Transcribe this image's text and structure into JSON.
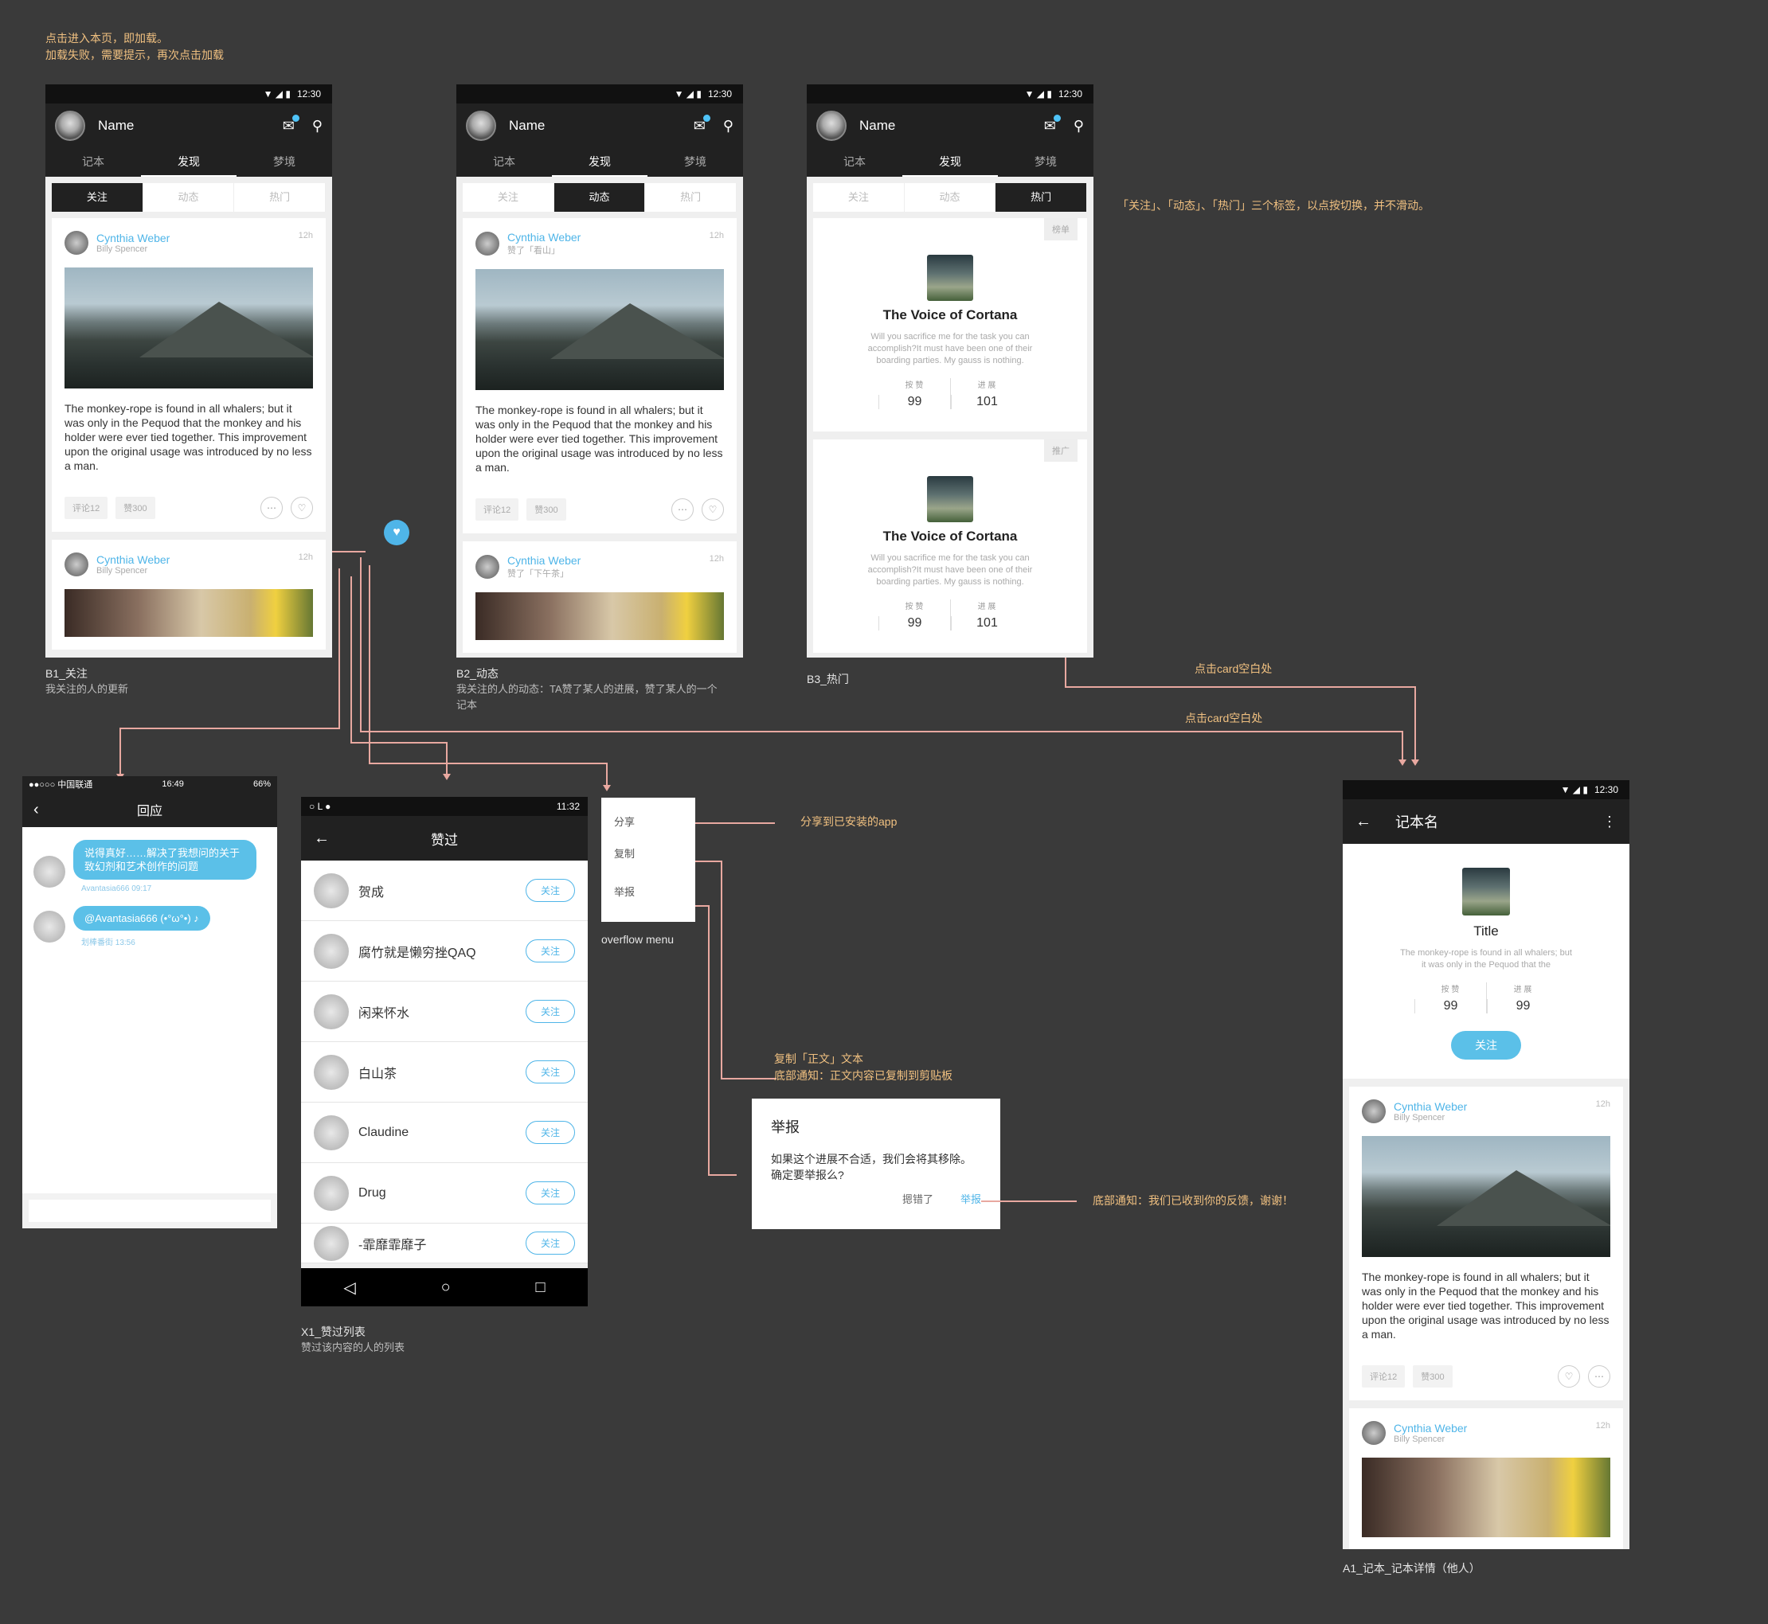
{
  "notes": {
    "top": [
      "点击进入本页，即加载。",
      "加载失败，需要提示，再次点击加载"
    ],
    "tabs_note": "「关注」、「动态」、「热门」三个标签，以点按切换，并不滑动。",
    "click_card_1": "点击card空白处",
    "click_card_2": "点击card空白处",
    "share": "分享到已安装的app",
    "copy": [
      "复制「正文」文本",
      "底部通知：正文内容已复制到剪贴板"
    ],
    "report_ok": "底部通知：我们已收到你的反馈，谢谢！"
  },
  "status": {
    "time": "12:30"
  },
  "app": {
    "name": "Name",
    "tabs": [
      "记本",
      "发现",
      "梦境"
    ],
    "seg": [
      "关注",
      "动态",
      "热门"
    ]
  },
  "b1": {
    "caption": "B1_关注",
    "sub": "我关注的人的更新",
    "card1": {
      "name": "Cynthia Weber",
      "sub": "Billy Spencer",
      "time": "12h",
      "body": "The monkey-rope is found in all whalers; but it was only in the Pequod that the monkey and his holder were ever tied together. This improvement upon the original usage was introduced by no less a man.",
      "comments": "评论12",
      "likes": "赞300"
    },
    "card2": {
      "name": "Cynthia Weber",
      "sub": "Billy Spencer",
      "time": "12h"
    }
  },
  "b2": {
    "caption": "B2_动态",
    "sub": "我关注的人的动态：TA赞了某人的进展，赞了某人的一个记本",
    "card1": {
      "name": "Cynthia Weber",
      "sub": "赞了「看山」",
      "time": "12h",
      "body": "The monkey-rope is found in all whalers; but it was only in the Pequod that the monkey and his holder were ever tied together. This improvement upon the original usage was introduced by no less a man.",
      "comments": "评论12",
      "likes": "赞300"
    },
    "card2": {
      "name": "Cynthia Weber",
      "sub": "赞了「下午茶」",
      "time": "12h"
    }
  },
  "b3": {
    "caption": "B3_热门",
    "card1": {
      "badge": "榜单",
      "title": "The Voice of Cortana",
      "desc": "Will you sacrifice me for the task you can accomplish?It must have been one of their boarding parties. My gauss is nothing.",
      "l1": "按 赞",
      "v1": "99",
      "l2": "进 展",
      "v2": "101"
    },
    "card2": {
      "badge": "推广",
      "title": "The Voice of Cortana",
      "desc": "Will you sacrifice me for the task you can accomplish?It must have been one of their boarding parties. My gauss is nothing.",
      "l1": "按 赞",
      "v1": "99",
      "l2": "进 展",
      "v2": "101"
    }
  },
  "reply": {
    "status_left": "●●○○○ 中国联通",
    "time": "16:49",
    "battery": "66%",
    "title": "回应",
    "m1": {
      "text": "说得真好……解决了我想问的关于致幻剂和艺术创作的问题",
      "meta": "Avantasia666  09:17"
    },
    "m2": {
      "text": "@Avantasia666 (•°ω°•) ♪",
      "meta": "划棒番街  13:56"
    }
  },
  "x1": {
    "caption": "X1_赞过列表",
    "sub": "赞过该内容的人的列表",
    "time": "11:32",
    "title": "赞过",
    "follow": "关注",
    "rows": [
      "贺成",
      "腐竹就是懒穷挫QAQ",
      "闲来怀水",
      "白山茶",
      "Claudine",
      "Drug",
      "-霏靡霏靡子"
    ]
  },
  "menu": {
    "items": [
      "分享",
      "复制",
      "举报"
    ],
    "caption": "overflow menu"
  },
  "dialog": {
    "title": "举报",
    "body": "如果这个进展不合适，我们会将其移除。确定要举报么?",
    "cancel": "摁错了",
    "ok": "举报"
  },
  "a1": {
    "caption": "A1_记本_记本详情（他人）",
    "title": "记本名",
    "nb_title": "Title",
    "nb_desc": "The monkey-rope is found in all whalers; but it was only in the Pequod that the",
    "l1": "按 赞",
    "v1": "99",
    "l2": "进 展",
    "v2": "99",
    "follow": "关注",
    "card1": {
      "name": "Cynthia Weber",
      "sub": "Billy Spencer",
      "time": "12h",
      "body": "The monkey-rope is found in all whalers; but it was only in the Pequod that the monkey and his holder were ever tied together. This improvement upon the original usage was introduced by no less a man.",
      "comments": "评论12",
      "likes": "赞300"
    },
    "card2": {
      "name": "Cynthia Weber",
      "sub": "Billy Spencer",
      "time": "12h"
    }
  }
}
